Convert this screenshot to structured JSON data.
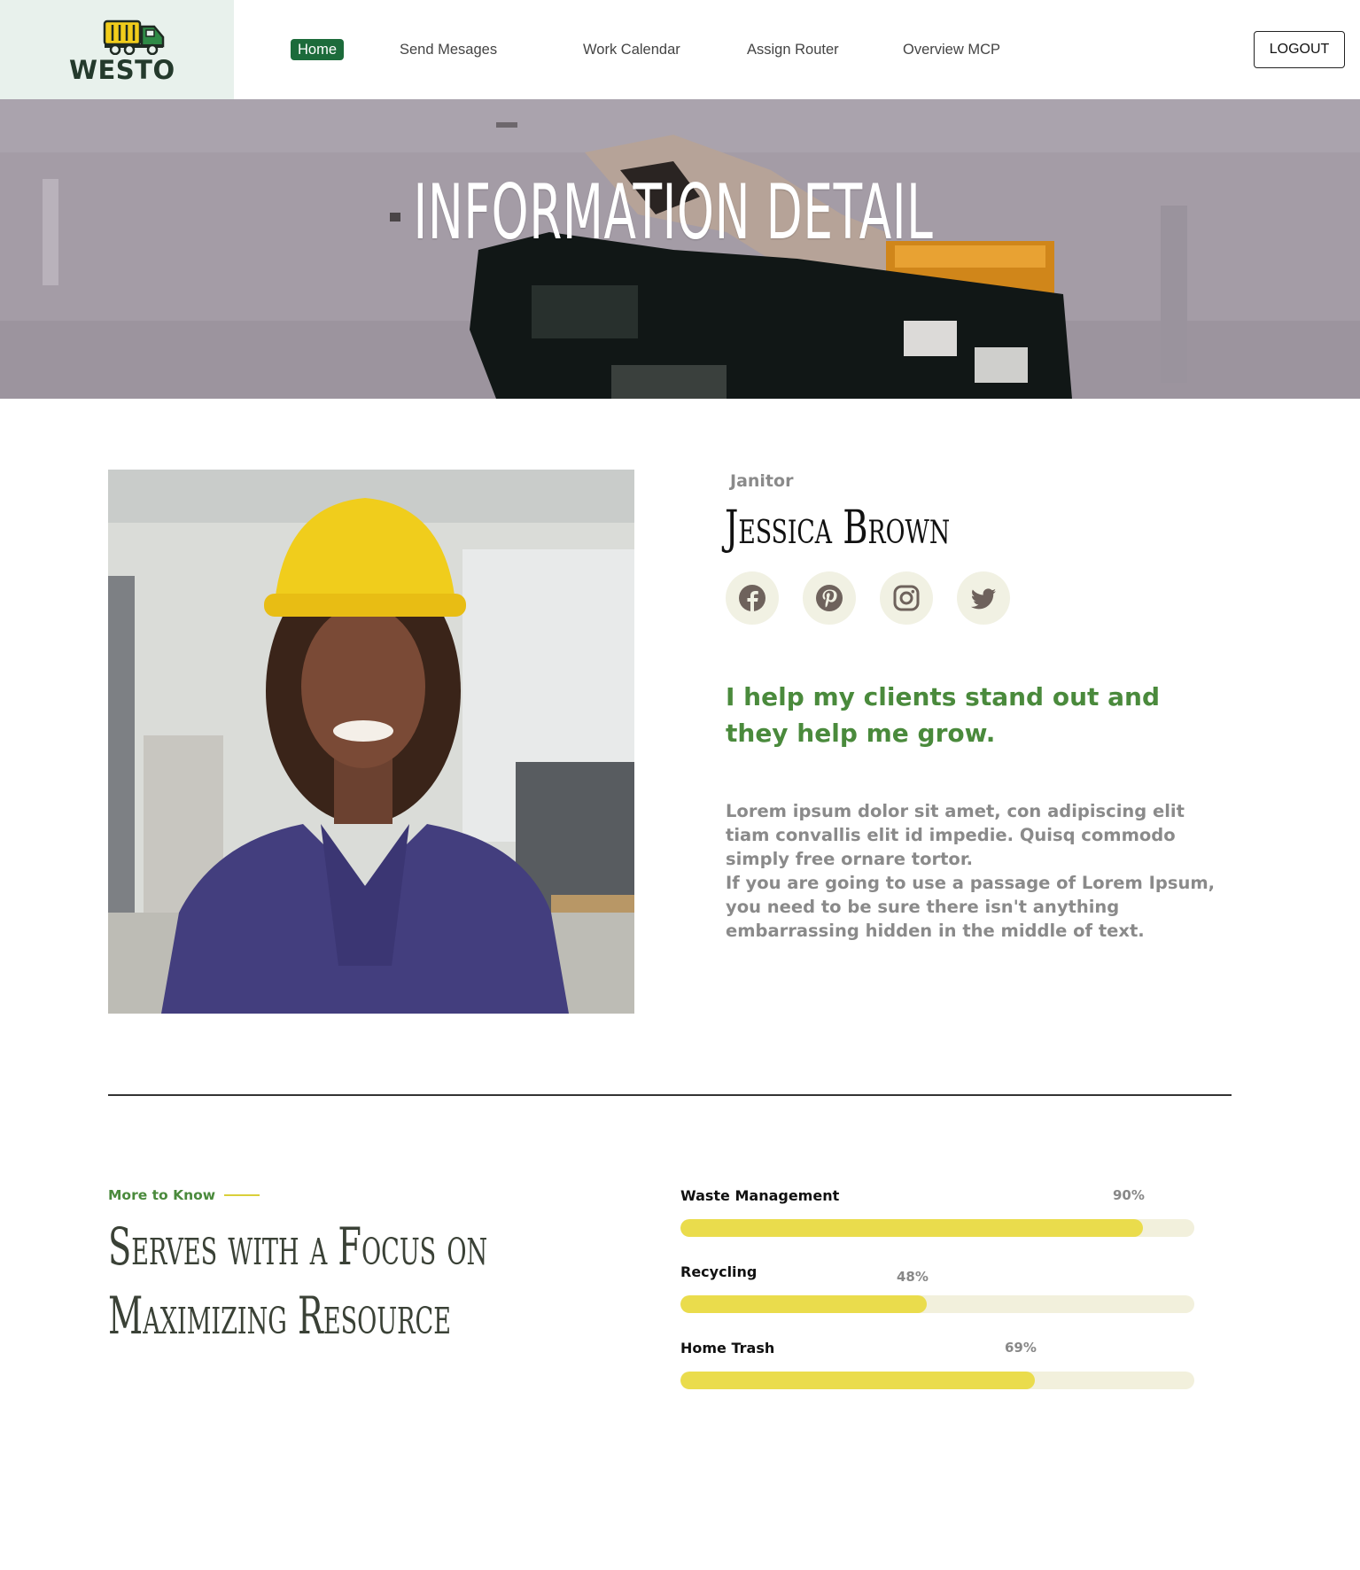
{
  "header": {
    "logo_text": "WESTO",
    "nav": [
      {
        "label": "Home",
        "active": true
      },
      {
        "label": "Send Mesages",
        "active": false
      },
      {
        "label": "Work Calendar",
        "active": false
      },
      {
        "label": "Assign Router",
        "active": false
      },
      {
        "label": "Overview MCP",
        "active": false
      }
    ],
    "logout_label": "LOGOUT"
  },
  "hero": {
    "title": "INFORMATION DETAIL"
  },
  "profile": {
    "role": "Janitor",
    "name": "Jessica Brown",
    "socials": [
      {
        "icon": "facebook-icon"
      },
      {
        "icon": "pinterest-icon"
      },
      {
        "icon": "instagram-icon"
      },
      {
        "icon": "twitter-icon"
      }
    ],
    "tagline": "I help my clients stand out and they help me grow.",
    "description_1": "Lorem ipsum dolor sit amet, con adipiscing elit tiam convallis elit id impedie. Quisq commodo simply free ornare tortor.",
    "description_2": "If you are going to use a passage of Lorem Ipsum, you need to be sure there isn't anything embarrassing hidden in the middle of text."
  },
  "more": {
    "eyebrow": "More to Know",
    "title": "Serves with a Focus on Maximizing Resource"
  },
  "skills": [
    {
      "label": "Waste Management",
      "percent_text": "90%",
      "value": 90
    },
    {
      "label": "Recycling",
      "percent_text": "48%",
      "value": 48
    },
    {
      "label": "Home Trash",
      "percent_text": "69%",
      "value": 69
    }
  ],
  "colors": {
    "brand_green": "#1c6b3b",
    "accent_green": "#4a8a3c",
    "progress_yellow": "#eadc4c",
    "progress_track": "#f2f0dc",
    "logo_bg": "#e8f1ec"
  }
}
